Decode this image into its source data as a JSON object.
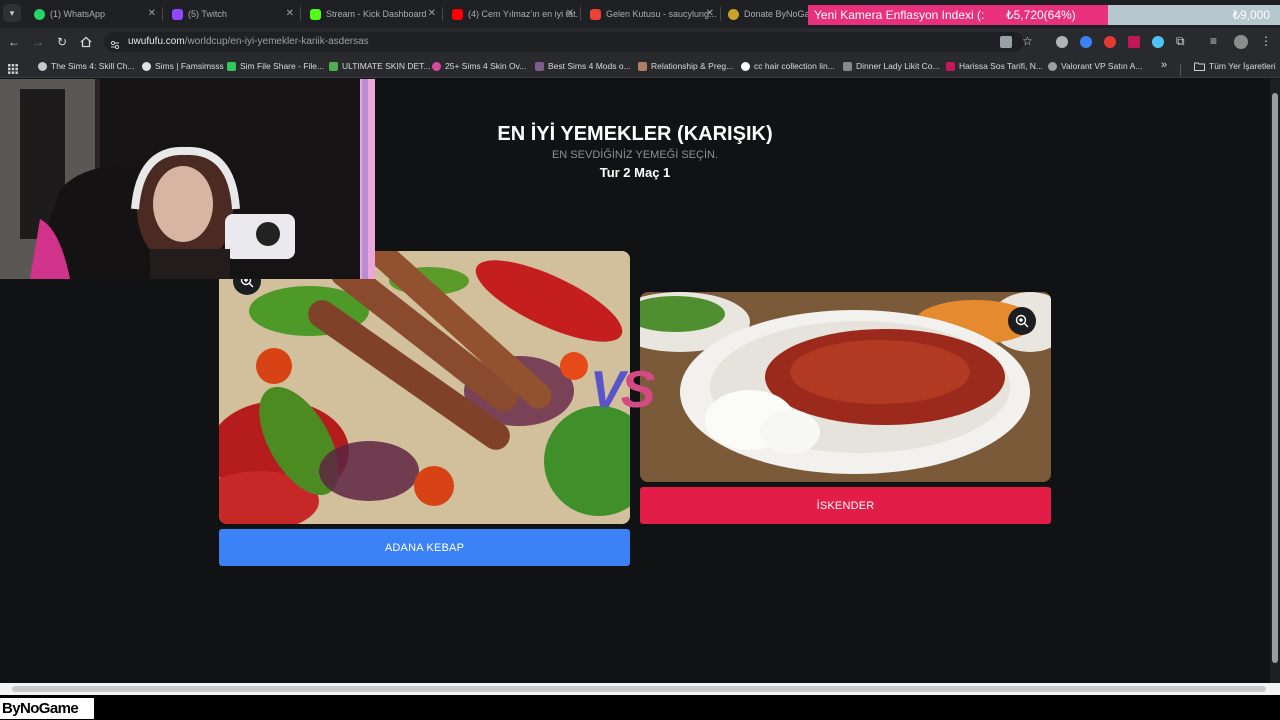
{
  "tabs": [
    {
      "title": "(1) WhatsApp",
      "color": "#25d366"
    },
    {
      "title": "(5) Twitch",
      "color": "#9146ff"
    },
    {
      "title": "Stream - Kick Dashboard",
      "color": "#53fc18"
    },
    {
      "title": "(4) Cem Yılmaz'ın en iyi tat...",
      "color": "#ff0000"
    },
    {
      "title": "Gelen Kutusu - saucylung...",
      "color": "#ea4335"
    },
    {
      "title": "Donate ByNoGame",
      "color": "#c9a227"
    }
  ],
  "overlay": {
    "title": "Yeni Kamera Enflasyon Indexi (:",
    "current": "₺5,720(64%)",
    "goal": "₺9,000",
    "progress_fraction": 0.64,
    "accent": "#e8307d"
  },
  "address_bar": {
    "host": "uwufufu.com",
    "path": "/worldcup/en-iyi-yemekler-kariik-asdersas"
  },
  "bookmarks": [
    {
      "label": "The Sims 4: Skill Ch...",
      "color": "#c7c7c7"
    },
    {
      "label": "Sims | Famsimsss",
      "color": "#e0e0e0"
    },
    {
      "label": "Sim File Share - File...",
      "color": "#34c759"
    },
    {
      "label": "ULTIMATE SKIN DET...",
      "color": "#4caf50"
    },
    {
      "label": "25+ Sims 4 Skin Ov...",
      "color": "#d6499b"
    },
    {
      "label": "Best Sims 4 Mods o...",
      "color": "#7a5c8e"
    },
    {
      "label": "Relationship & Preg...",
      "color": "#b07d62"
    },
    {
      "label": "cc hair collection lin...",
      "color": "#ffffff"
    },
    {
      "label": "Dinner Lady Likit Co...",
      "color": "#888888"
    },
    {
      "label": "Harissa Sos Tarifi, N...",
      "color": "#c2185b"
    },
    {
      "label": "Valorant VP Satın A...",
      "color": "#9e9e9e"
    }
  ],
  "bookmarks_more": "»",
  "all_bookmarks": "Tüm Yer İşaretleri",
  "page": {
    "title": "EN İYİ YEMEKLER (KARIŞIK)",
    "subtitle": "EN SEVDİĞİNİZ YEMEĞİ SEÇİN.",
    "round": "Tur 2 Maç 1"
  },
  "choices": {
    "left": {
      "label": "ADANA KEBAP",
      "color": "#3b82f6"
    },
    "right": {
      "label": "İSKENDER",
      "color": "#e11d48"
    }
  },
  "vs_text": "VS",
  "brand": "ByNoGame"
}
